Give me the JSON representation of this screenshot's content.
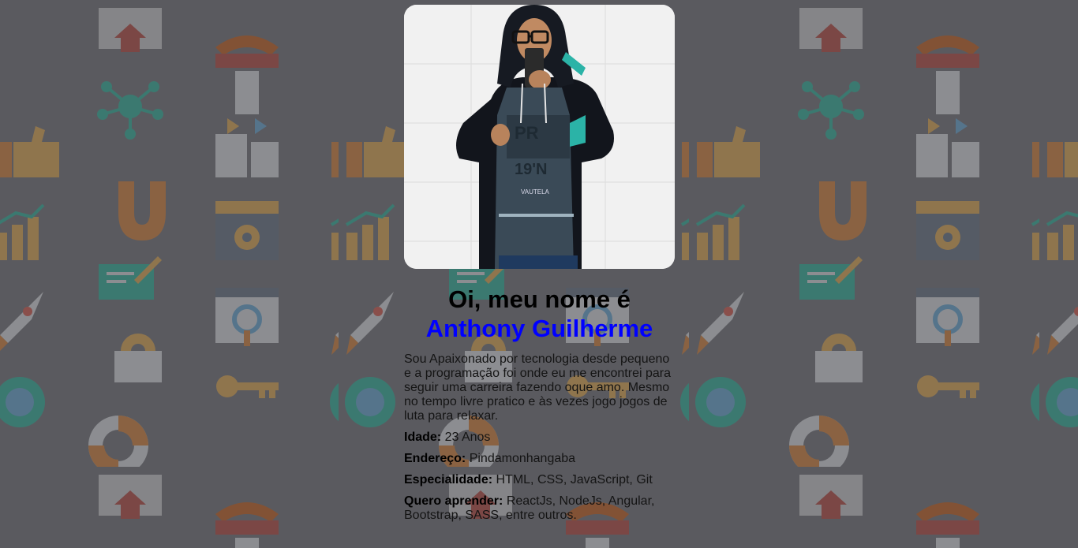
{
  "profile": {
    "photo_alt": "Anthony Guilherme",
    "greeting": "Oi, meu nome é",
    "name": "Anthony Guilherme",
    "bio": "Sou Apaixonado por tecnologia desde pequeno e a programação foi onde eu me encontrei para seguir uma carreira fazendo oque amo. Mesmo no tempo livre pratico e às vezes jogo jogos de luta para relaxar.",
    "fields": [
      {
        "label": "Idade:",
        "value": "23 Anos"
      },
      {
        "label": "Endereço:",
        "value": "Pindamonhangaba"
      },
      {
        "label": "Especialidade:",
        "value": "HTML, CSS, JavaScript, Git"
      },
      {
        "label": "Quero aprender:",
        "value": "ReactJs, NodeJs, Angular, Bootstrap, SASS, entre outros."
      }
    ]
  },
  "shirt_text": {
    "line1": "19'N",
    "line2": "VAUTELA"
  },
  "colors": {
    "name_accent": "#0000ff",
    "background": "#5d5e63"
  },
  "background_icons": [
    "house-icon",
    "lightbulb-icon",
    "network-icon",
    "thumbs-up-icon",
    "magnet-icon",
    "bar-chart-icon",
    "gear-icon",
    "rocket-icon",
    "magnifier-icon",
    "key-icon",
    "lifebuoy-icon",
    "calendar-icon",
    "globe-icon",
    "chat-icon"
  ]
}
